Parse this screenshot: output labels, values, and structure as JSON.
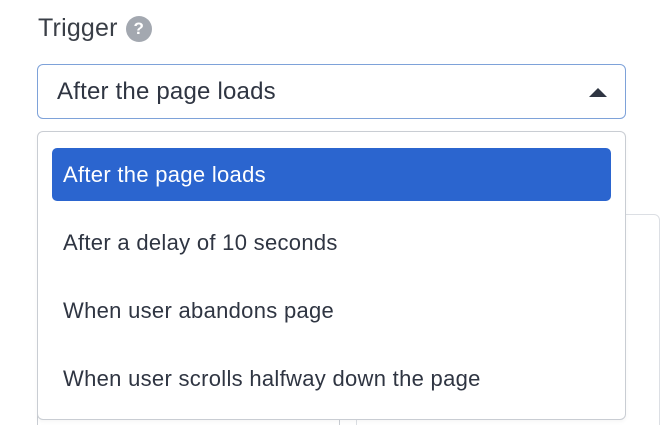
{
  "field": {
    "label": "Trigger",
    "help_icon_glyph": "?",
    "help_icon_name": "question-circle-icon"
  },
  "select": {
    "value": "After the page loads",
    "caret_icon_name": "caret-up-icon",
    "is_open": true
  },
  "options": [
    {
      "label": "After the page loads",
      "selected": true
    },
    {
      "label": "After a delay of 10 seconds",
      "selected": false
    },
    {
      "label": "When user abandons page",
      "selected": false
    },
    {
      "label": "When user scrolls halfway down the page",
      "selected": false
    }
  ],
  "colors": {
    "selected_bg": "#2b65cf",
    "focus_border": "#7ea2d9",
    "text": "#2f3542",
    "help_icon_bg": "#a3a8b0"
  }
}
